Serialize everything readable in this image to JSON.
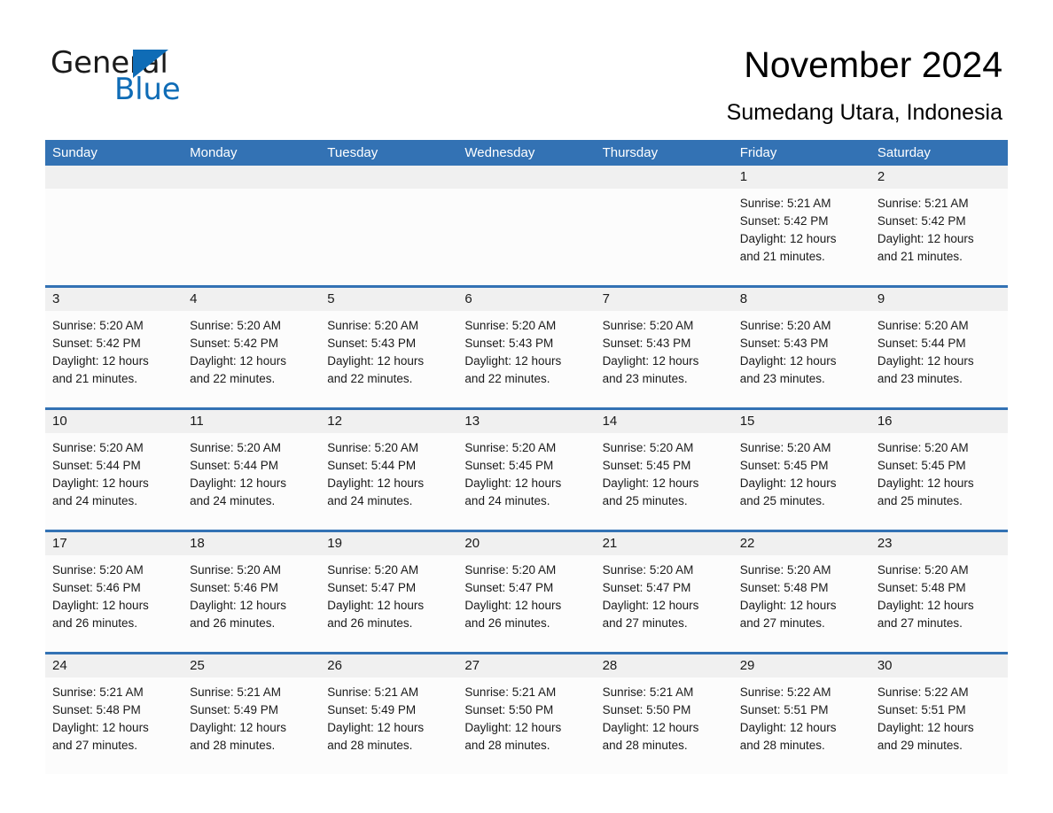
{
  "brand": {
    "name_part1": "General",
    "name_part2": "Blue",
    "triangle_color": "#0f6cb6"
  },
  "header": {
    "title": "November 2024",
    "subtitle": "Sumedang Utara, Indonesia"
  },
  "theme": {
    "header_blue": "#3372B4",
    "date_band_gray": "#F0F0F0",
    "cell_bg": "#FCFCFC",
    "text": "#1a1a1a"
  },
  "weekdays": [
    "Sunday",
    "Monday",
    "Tuesday",
    "Wednesday",
    "Thursday",
    "Friday",
    "Saturday"
  ],
  "weeks": [
    [
      {
        "date": "",
        "lines": []
      },
      {
        "date": "",
        "lines": []
      },
      {
        "date": "",
        "lines": []
      },
      {
        "date": "",
        "lines": []
      },
      {
        "date": "",
        "lines": []
      },
      {
        "date": "1",
        "lines": [
          "Sunrise: 5:21 AM",
          "Sunset: 5:42 PM",
          "Daylight: 12 hours",
          "and 21 minutes."
        ]
      },
      {
        "date": "2",
        "lines": [
          "Sunrise: 5:21 AM",
          "Sunset: 5:42 PM",
          "Daylight: 12 hours",
          "and 21 minutes."
        ]
      }
    ],
    [
      {
        "date": "3",
        "lines": [
          "Sunrise: 5:20 AM",
          "Sunset: 5:42 PM",
          "Daylight: 12 hours",
          "and 21 minutes."
        ]
      },
      {
        "date": "4",
        "lines": [
          "Sunrise: 5:20 AM",
          "Sunset: 5:42 PM",
          "Daylight: 12 hours",
          "and 22 minutes."
        ]
      },
      {
        "date": "5",
        "lines": [
          "Sunrise: 5:20 AM",
          "Sunset: 5:43 PM",
          "Daylight: 12 hours",
          "and 22 minutes."
        ]
      },
      {
        "date": "6",
        "lines": [
          "Sunrise: 5:20 AM",
          "Sunset: 5:43 PM",
          "Daylight: 12 hours",
          "and 22 minutes."
        ]
      },
      {
        "date": "7",
        "lines": [
          "Sunrise: 5:20 AM",
          "Sunset: 5:43 PM",
          "Daylight: 12 hours",
          "and 23 minutes."
        ]
      },
      {
        "date": "8",
        "lines": [
          "Sunrise: 5:20 AM",
          "Sunset: 5:43 PM",
          "Daylight: 12 hours",
          "and 23 minutes."
        ]
      },
      {
        "date": "9",
        "lines": [
          "Sunrise: 5:20 AM",
          "Sunset: 5:44 PM",
          "Daylight: 12 hours",
          "and 23 minutes."
        ]
      }
    ],
    [
      {
        "date": "10",
        "lines": [
          "Sunrise: 5:20 AM",
          "Sunset: 5:44 PM",
          "Daylight: 12 hours",
          "and 24 minutes."
        ]
      },
      {
        "date": "11",
        "lines": [
          "Sunrise: 5:20 AM",
          "Sunset: 5:44 PM",
          "Daylight: 12 hours",
          "and 24 minutes."
        ]
      },
      {
        "date": "12",
        "lines": [
          "Sunrise: 5:20 AM",
          "Sunset: 5:44 PM",
          "Daylight: 12 hours",
          "and 24 minutes."
        ]
      },
      {
        "date": "13",
        "lines": [
          "Sunrise: 5:20 AM",
          "Sunset: 5:45 PM",
          "Daylight: 12 hours",
          "and 24 minutes."
        ]
      },
      {
        "date": "14",
        "lines": [
          "Sunrise: 5:20 AM",
          "Sunset: 5:45 PM",
          "Daylight: 12 hours",
          "and 25 minutes."
        ]
      },
      {
        "date": "15",
        "lines": [
          "Sunrise: 5:20 AM",
          "Sunset: 5:45 PM",
          "Daylight: 12 hours",
          "and 25 minutes."
        ]
      },
      {
        "date": "16",
        "lines": [
          "Sunrise: 5:20 AM",
          "Sunset: 5:45 PM",
          "Daylight: 12 hours",
          "and 25 minutes."
        ]
      }
    ],
    [
      {
        "date": "17",
        "lines": [
          "Sunrise: 5:20 AM",
          "Sunset: 5:46 PM",
          "Daylight: 12 hours",
          "and 26 minutes."
        ]
      },
      {
        "date": "18",
        "lines": [
          "Sunrise: 5:20 AM",
          "Sunset: 5:46 PM",
          "Daylight: 12 hours",
          "and 26 minutes."
        ]
      },
      {
        "date": "19",
        "lines": [
          "Sunrise: 5:20 AM",
          "Sunset: 5:47 PM",
          "Daylight: 12 hours",
          "and 26 minutes."
        ]
      },
      {
        "date": "20",
        "lines": [
          "Sunrise: 5:20 AM",
          "Sunset: 5:47 PM",
          "Daylight: 12 hours",
          "and 26 minutes."
        ]
      },
      {
        "date": "21",
        "lines": [
          "Sunrise: 5:20 AM",
          "Sunset: 5:47 PM",
          "Daylight: 12 hours",
          "and 27 minutes."
        ]
      },
      {
        "date": "22",
        "lines": [
          "Sunrise: 5:20 AM",
          "Sunset: 5:48 PM",
          "Daylight: 12 hours",
          "and 27 minutes."
        ]
      },
      {
        "date": "23",
        "lines": [
          "Sunrise: 5:20 AM",
          "Sunset: 5:48 PM",
          "Daylight: 12 hours",
          "and 27 minutes."
        ]
      }
    ],
    [
      {
        "date": "24",
        "lines": [
          "Sunrise: 5:21 AM",
          "Sunset: 5:48 PM",
          "Daylight: 12 hours",
          "and 27 minutes."
        ]
      },
      {
        "date": "25",
        "lines": [
          "Sunrise: 5:21 AM",
          "Sunset: 5:49 PM",
          "Daylight: 12 hours",
          "and 28 minutes."
        ]
      },
      {
        "date": "26",
        "lines": [
          "Sunrise: 5:21 AM",
          "Sunset: 5:49 PM",
          "Daylight: 12 hours",
          "and 28 minutes."
        ]
      },
      {
        "date": "27",
        "lines": [
          "Sunrise: 5:21 AM",
          "Sunset: 5:50 PM",
          "Daylight: 12 hours",
          "and 28 minutes."
        ]
      },
      {
        "date": "28",
        "lines": [
          "Sunrise: 5:21 AM",
          "Sunset: 5:50 PM",
          "Daylight: 12 hours",
          "and 28 minutes."
        ]
      },
      {
        "date": "29",
        "lines": [
          "Sunrise: 5:22 AM",
          "Sunset: 5:51 PM",
          "Daylight: 12 hours",
          "and 28 minutes."
        ]
      },
      {
        "date": "30",
        "lines": [
          "Sunrise: 5:22 AM",
          "Sunset: 5:51 PM",
          "Daylight: 12 hours",
          "and 29 minutes."
        ]
      }
    ]
  ]
}
